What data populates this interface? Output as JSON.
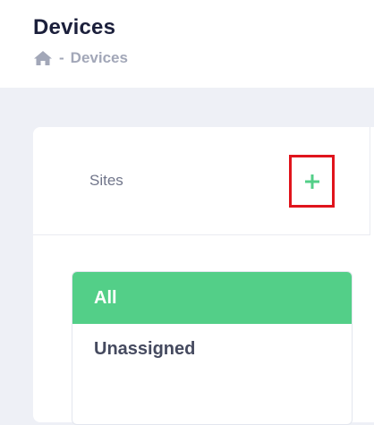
{
  "header": {
    "title": "Devices",
    "breadcrumb": {
      "home_icon": "home-icon",
      "separator": "-",
      "current": "Devices"
    }
  },
  "sites": {
    "label": "Sites",
    "add_button_icon": "plus-icon",
    "items": [
      {
        "label": "All",
        "selected": true
      },
      {
        "label": "Unassigned",
        "selected": false
      }
    ]
  },
  "colors": {
    "accent_green": "#53cf88",
    "highlight_red": "#e0141c",
    "title_text": "#1b1f3b",
    "muted_text": "#a2a7b8"
  }
}
